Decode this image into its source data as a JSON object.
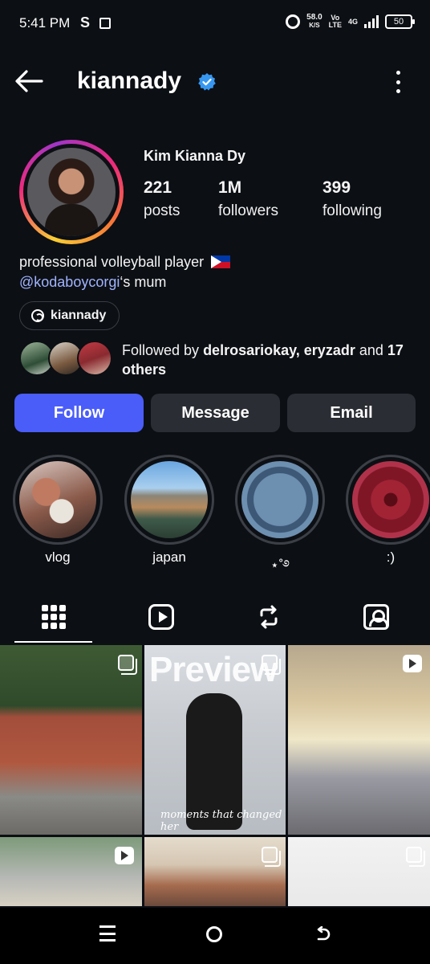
{
  "status_bar": {
    "time": "5:41 PM",
    "carrier_icon": "S",
    "net_speed_value": "58.0",
    "net_speed_unit": "K/S",
    "volte_top": "Vo",
    "volte_bottom": "LTE",
    "network": "4G",
    "battery": "50"
  },
  "header": {
    "username": "kiannady",
    "verified": true
  },
  "profile": {
    "full_name": "Kim Kianna Dy",
    "stats": [
      {
        "value": "221",
        "label": "posts"
      },
      {
        "value": "1M",
        "label": "followers"
      },
      {
        "value": "399",
        "label": "following"
      }
    ],
    "bio_line1": "professional volleyball player",
    "bio_mention": "@kodaboycorgi",
    "bio_line2_suffix": "‘s mum",
    "threads_handle": "kiannady",
    "followed_by_prefix": "Followed by",
    "followed_by_names": "delrosariokay, eryzadr",
    "followed_by_and": "and",
    "followed_by_others": "17 others"
  },
  "actions": {
    "follow": "Follow",
    "message": "Message",
    "email": "Email"
  },
  "highlights": [
    {
      "label": "vlog"
    },
    {
      "label": "japan"
    },
    {
      "label": "⋆˚࿔"
    },
    {
      "label": ":)"
    }
  ],
  "tabs": [
    {
      "name": "grid",
      "icon": "grid-icon",
      "active": true
    },
    {
      "name": "reels",
      "icon": "reels-icon",
      "active": false
    },
    {
      "name": "reposts",
      "icon": "repost-icon",
      "active": false
    },
    {
      "name": "tagged",
      "icon": "tagged-icon",
      "active": false
    }
  ],
  "posts": {
    "preview_title": "Preview",
    "preview_caption": "moments that changed her"
  },
  "colors": {
    "background": "#0c0f14",
    "follow_button": "#4a5df9",
    "secondary_button": "#2a2d33",
    "mention": "#a0b4ff",
    "verified": "#3797f0"
  }
}
